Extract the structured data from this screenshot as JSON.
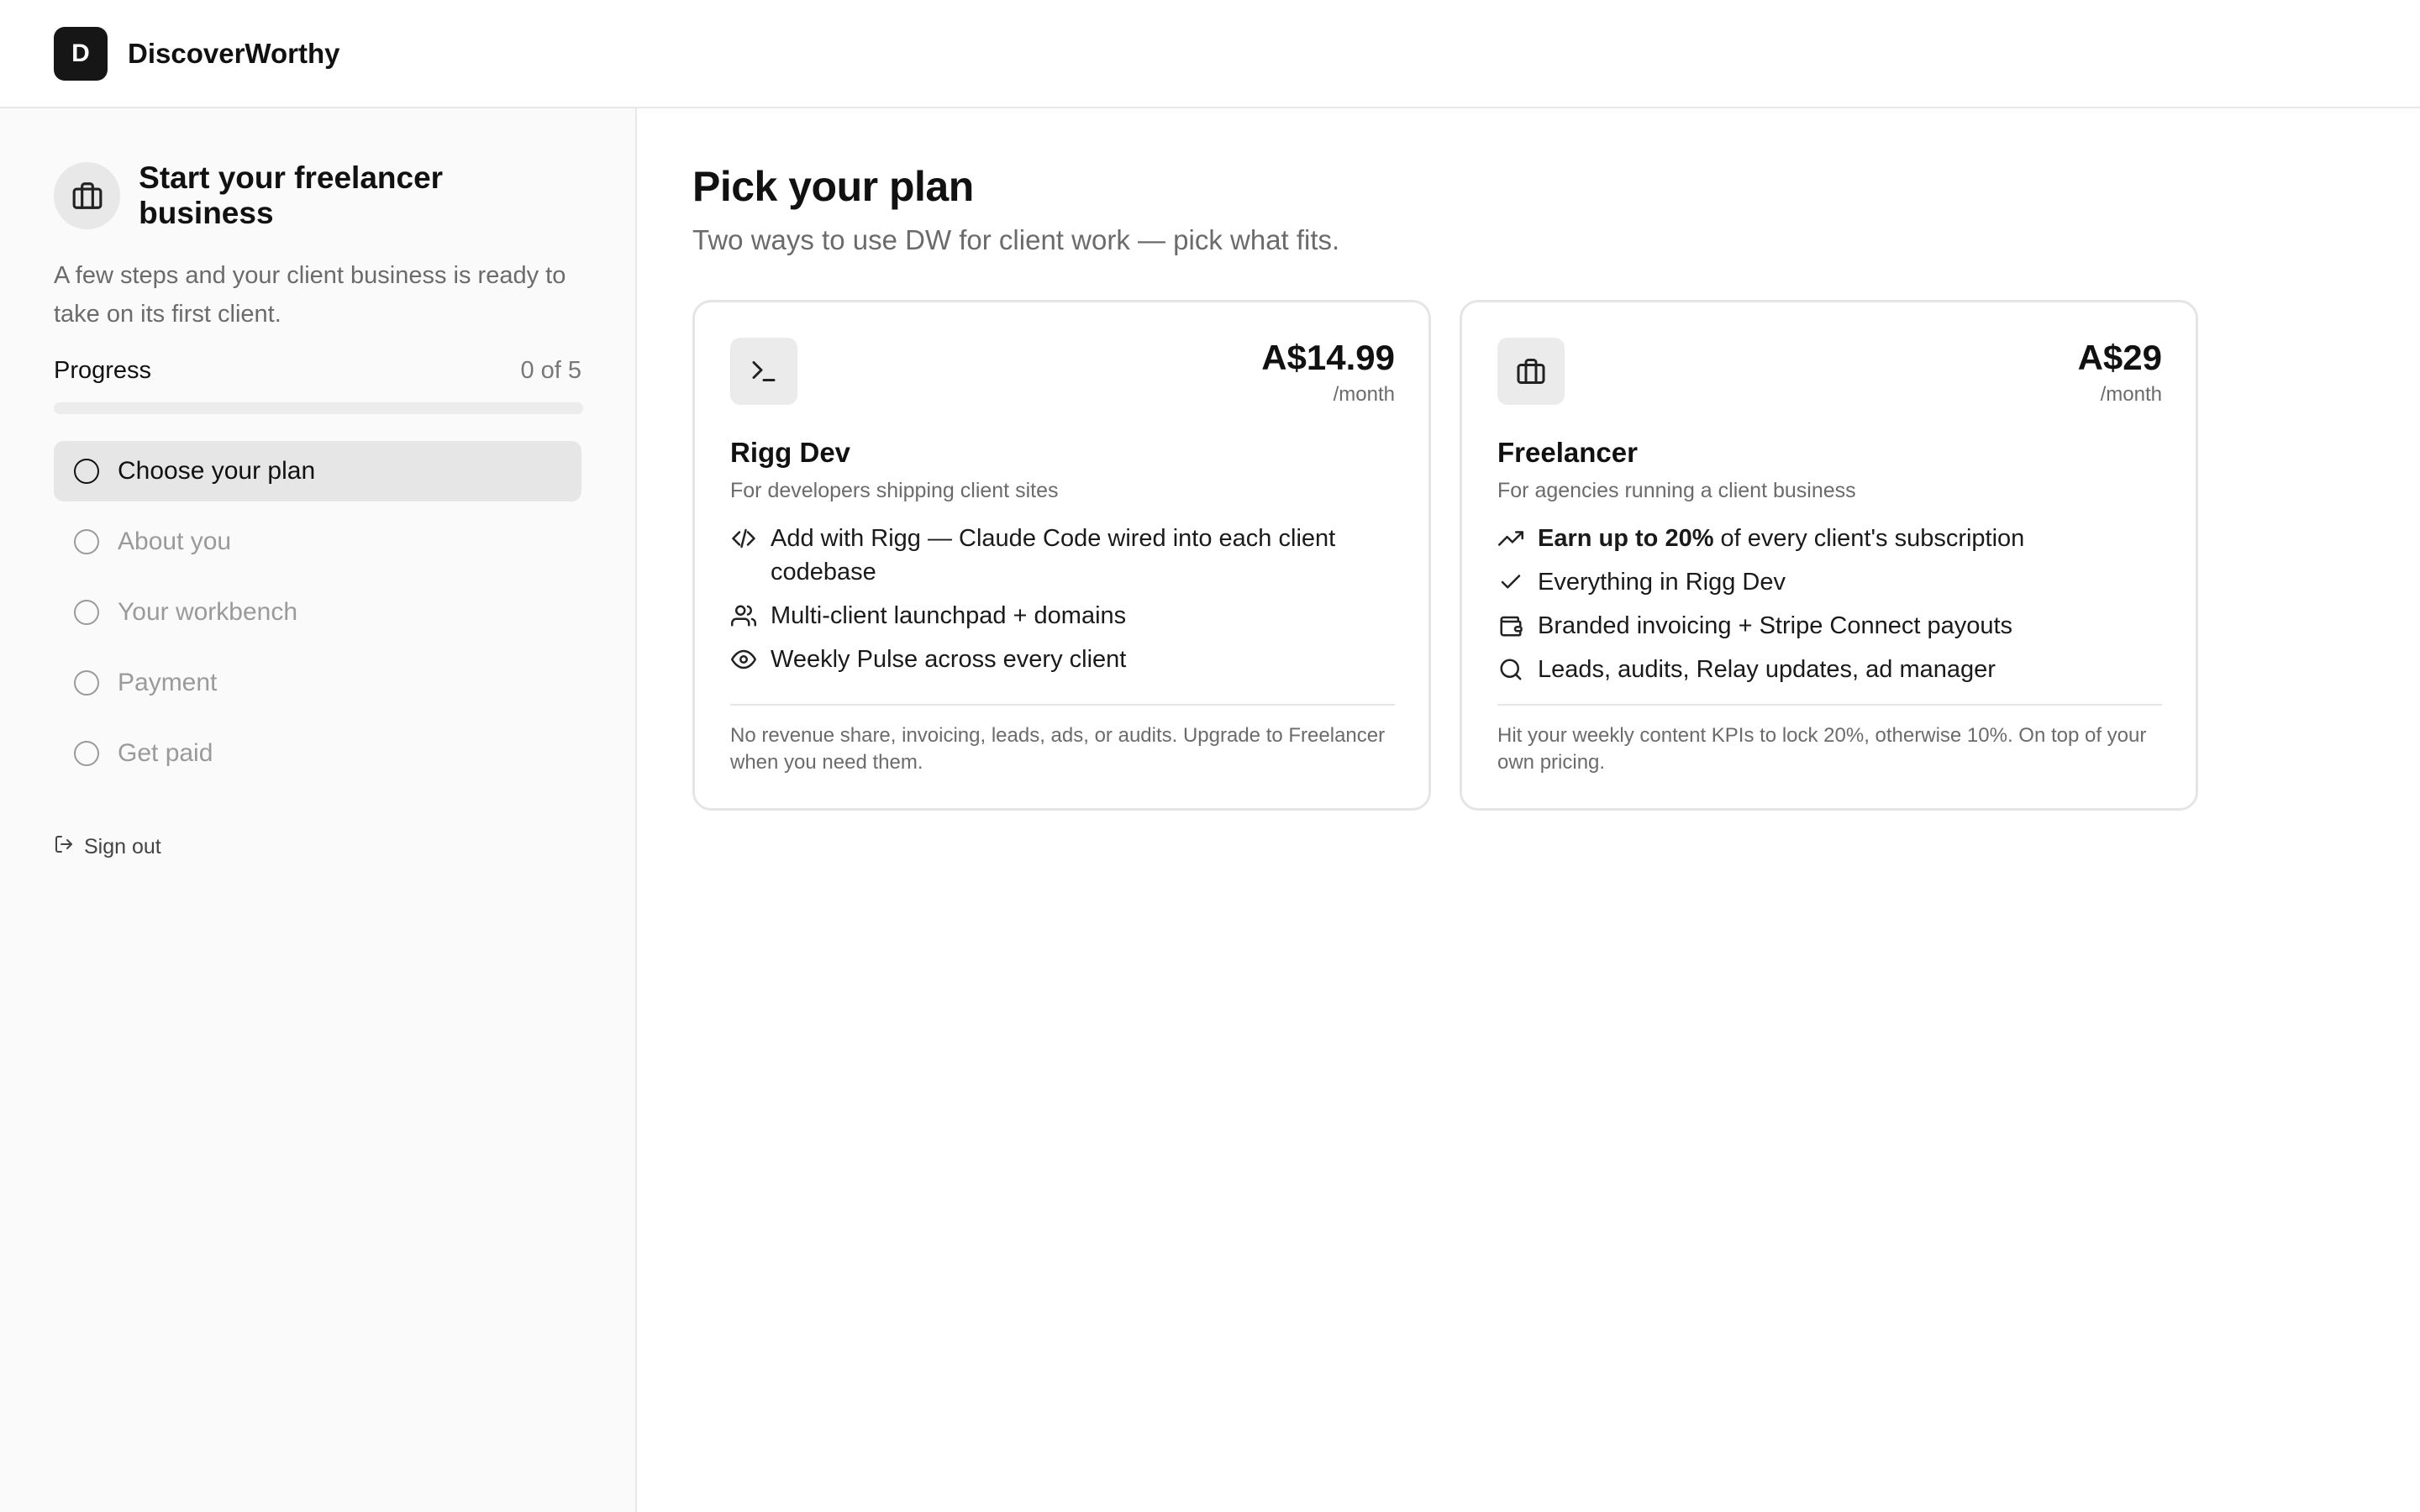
{
  "brand": {
    "logo_letter": "D",
    "name": "DiscoverWorthy"
  },
  "sidebar": {
    "title": "Start your freelancer business",
    "description": "A few steps and your client business is ready to take on its first client.",
    "progress_label": "Progress",
    "progress_count": "0 of 5",
    "progress_fraction": 0,
    "steps": [
      {
        "label": "Choose your plan",
        "active": true
      },
      {
        "label": "About you",
        "active": false
      },
      {
        "label": "Your workbench",
        "active": false
      },
      {
        "label": "Payment",
        "active": false
      },
      {
        "label": "Get paid",
        "active": false
      }
    ],
    "sign_out": "Sign out"
  },
  "main": {
    "title": "Pick your plan",
    "subtitle": "Two ways to use DW for client work — pick what fits.",
    "plans": [
      {
        "icon": "terminal-icon",
        "price": "A$14.99",
        "period": "/month",
        "name": "Rigg Dev",
        "description": "For developers shipping client sites",
        "features": [
          {
            "icon": "code-icon",
            "text": "Add with Rigg — Claude Code wired into each client codebase"
          },
          {
            "icon": "users-icon",
            "text": "Multi-client launchpad + domains"
          },
          {
            "icon": "eye-icon",
            "text": "Weekly Pulse across every client"
          }
        ],
        "footnote": "No revenue share, invoicing, leads, ads, or audits. Upgrade to Freelancer when you need them."
      },
      {
        "icon": "briefcase-icon",
        "price": "A$29",
        "period": "/month",
        "name": "Freelancer",
        "description": "For agencies running a client business",
        "features": [
          {
            "icon": "trending-up-icon",
            "bold": "Earn up to 20%",
            "text": " of every client's subscription"
          },
          {
            "icon": "check-icon",
            "text": "Everything in Rigg Dev"
          },
          {
            "icon": "wallet-icon",
            "text": "Branded invoicing + Stripe Connect payouts"
          },
          {
            "icon": "search-icon",
            "text": "Leads, audits, Relay updates, ad manager"
          }
        ],
        "footnote": "Hit your weekly content KPIs to lock 20%, otherwise 10%. On top of your own pricing."
      }
    ]
  }
}
